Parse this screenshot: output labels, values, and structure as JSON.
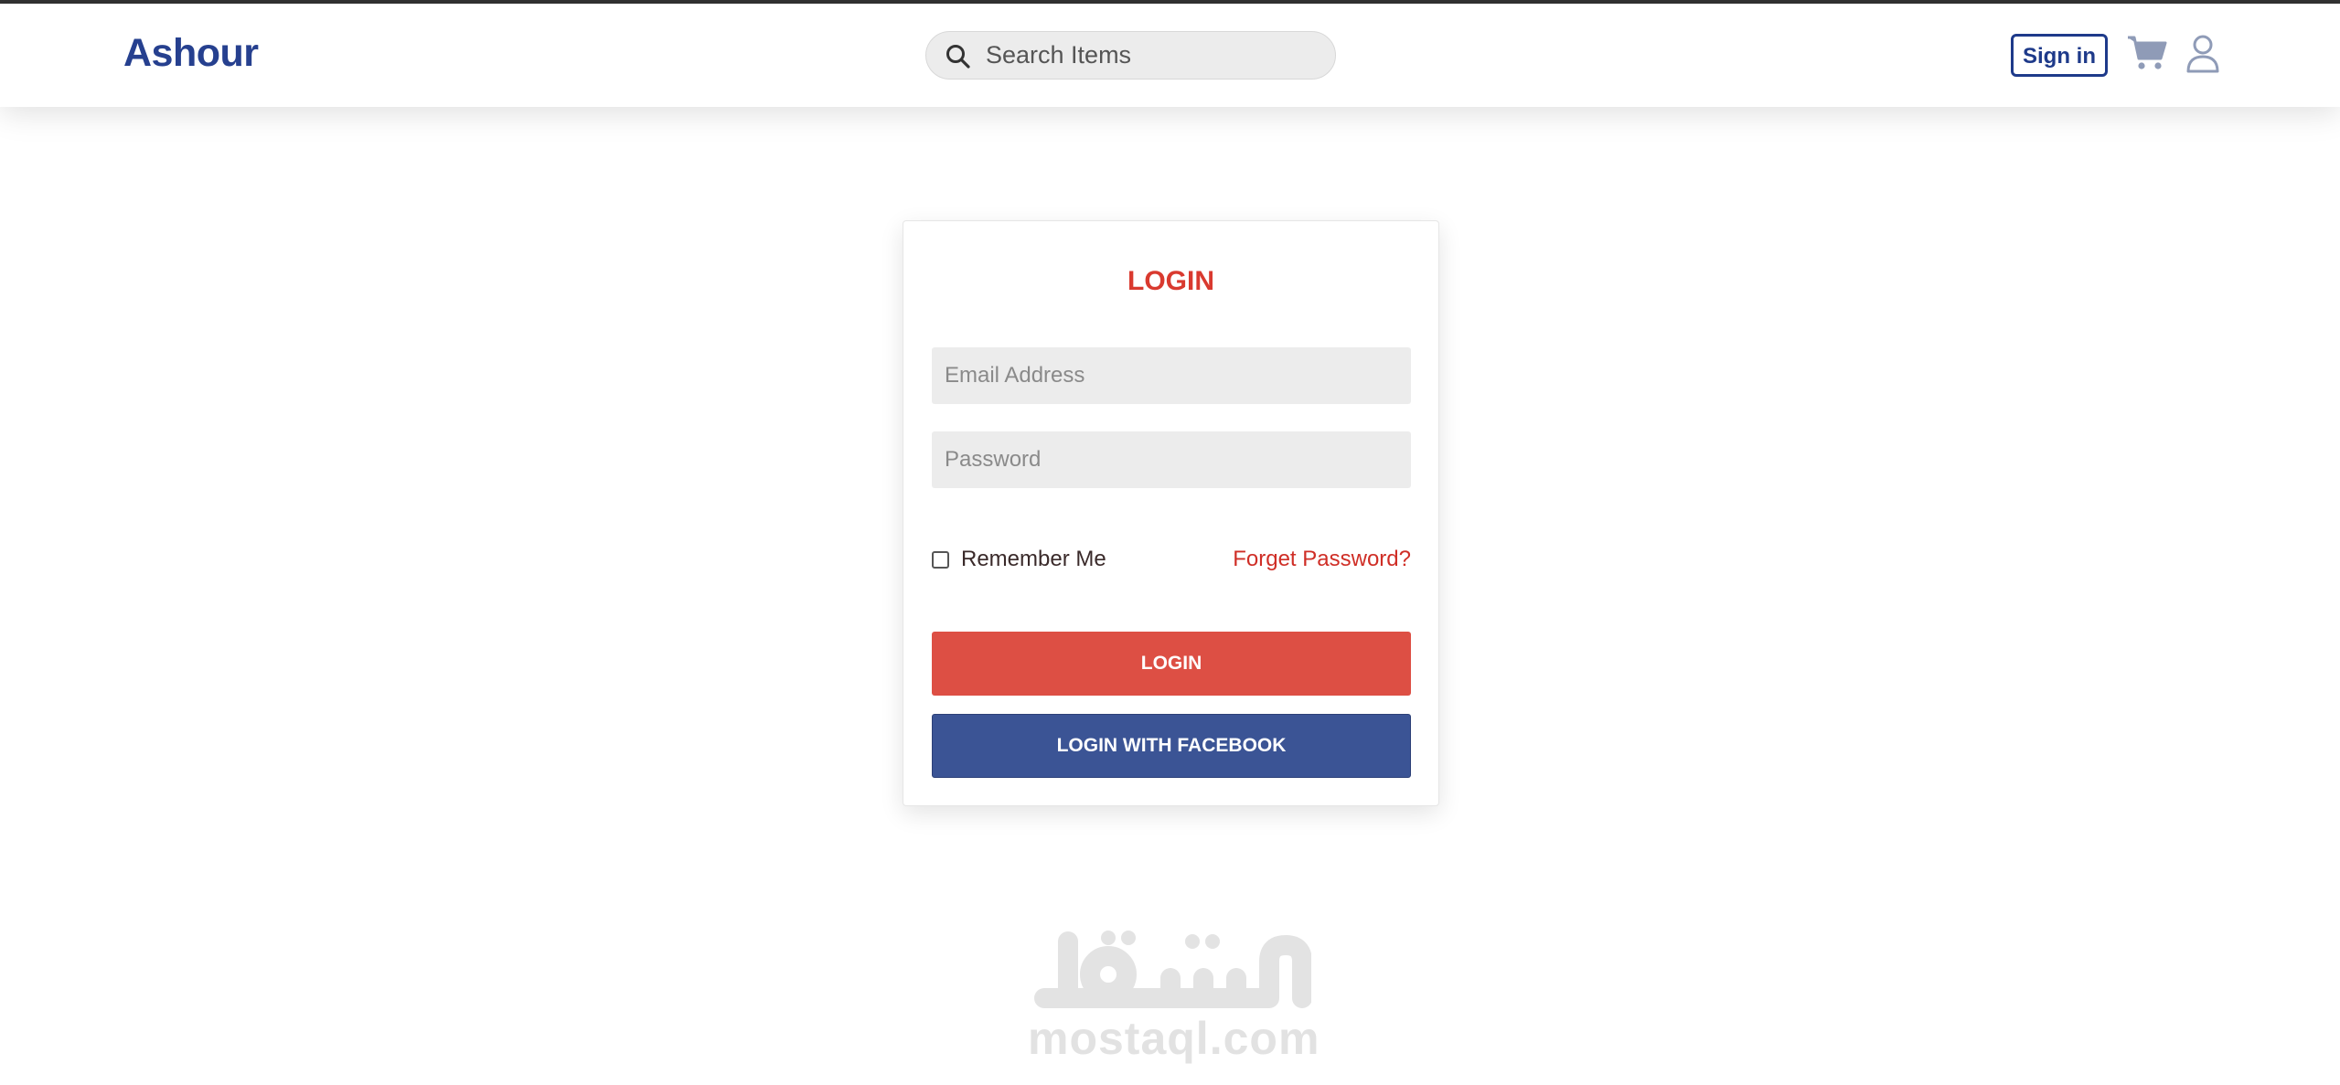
{
  "header": {
    "brand": "Ashour",
    "search_placeholder": "Search Items",
    "signin_label": "Sign in",
    "icons": [
      "search-icon",
      "cart-icon",
      "user-icon"
    ],
    "brand_color": "#26408f"
  },
  "login_card": {
    "title": "LOGIN",
    "email_placeholder": "Email Address",
    "password_placeholder": "Password",
    "remember_label": "Remember Me",
    "remember_checked": false,
    "forget_label": "Forget Password?",
    "login_button": "LOGIN",
    "facebook_button": "LOGIN WITH FACEBOOK",
    "accent_color": "#dd4f44",
    "facebook_color": "#3b5495"
  },
  "watermark": {
    "text": "mostaql.com",
    "arabic": "مستقل"
  }
}
